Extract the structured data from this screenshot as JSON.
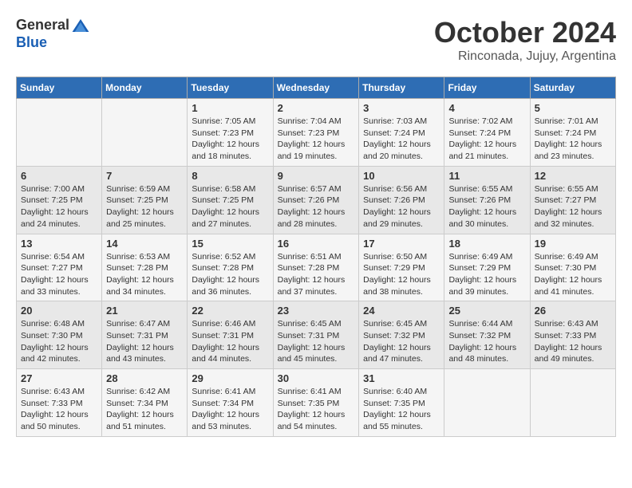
{
  "logo": {
    "general": "General",
    "blue": "Blue"
  },
  "title": "October 2024",
  "location": "Rinconada, Jujuy, Argentina",
  "weekdays": [
    "Sunday",
    "Monday",
    "Tuesday",
    "Wednesday",
    "Thursday",
    "Friday",
    "Saturday"
  ],
  "weeks": [
    [
      {
        "day": "",
        "info": ""
      },
      {
        "day": "",
        "info": ""
      },
      {
        "day": "1",
        "info": "Sunrise: 7:05 AM\nSunset: 7:23 PM\nDaylight: 12 hours\nand 18 minutes."
      },
      {
        "day": "2",
        "info": "Sunrise: 7:04 AM\nSunset: 7:23 PM\nDaylight: 12 hours\nand 19 minutes."
      },
      {
        "day": "3",
        "info": "Sunrise: 7:03 AM\nSunset: 7:24 PM\nDaylight: 12 hours\nand 20 minutes."
      },
      {
        "day": "4",
        "info": "Sunrise: 7:02 AM\nSunset: 7:24 PM\nDaylight: 12 hours\nand 21 minutes."
      },
      {
        "day": "5",
        "info": "Sunrise: 7:01 AM\nSunset: 7:24 PM\nDaylight: 12 hours\nand 23 minutes."
      }
    ],
    [
      {
        "day": "6",
        "info": "Sunrise: 7:00 AM\nSunset: 7:25 PM\nDaylight: 12 hours\nand 24 minutes."
      },
      {
        "day": "7",
        "info": "Sunrise: 6:59 AM\nSunset: 7:25 PM\nDaylight: 12 hours\nand 25 minutes."
      },
      {
        "day": "8",
        "info": "Sunrise: 6:58 AM\nSunset: 7:25 PM\nDaylight: 12 hours\nand 27 minutes."
      },
      {
        "day": "9",
        "info": "Sunrise: 6:57 AM\nSunset: 7:26 PM\nDaylight: 12 hours\nand 28 minutes."
      },
      {
        "day": "10",
        "info": "Sunrise: 6:56 AM\nSunset: 7:26 PM\nDaylight: 12 hours\nand 29 minutes."
      },
      {
        "day": "11",
        "info": "Sunrise: 6:55 AM\nSunset: 7:26 PM\nDaylight: 12 hours\nand 30 minutes."
      },
      {
        "day": "12",
        "info": "Sunrise: 6:55 AM\nSunset: 7:27 PM\nDaylight: 12 hours\nand 32 minutes."
      }
    ],
    [
      {
        "day": "13",
        "info": "Sunrise: 6:54 AM\nSunset: 7:27 PM\nDaylight: 12 hours\nand 33 minutes."
      },
      {
        "day": "14",
        "info": "Sunrise: 6:53 AM\nSunset: 7:28 PM\nDaylight: 12 hours\nand 34 minutes."
      },
      {
        "day": "15",
        "info": "Sunrise: 6:52 AM\nSunset: 7:28 PM\nDaylight: 12 hours\nand 36 minutes."
      },
      {
        "day": "16",
        "info": "Sunrise: 6:51 AM\nSunset: 7:28 PM\nDaylight: 12 hours\nand 37 minutes."
      },
      {
        "day": "17",
        "info": "Sunrise: 6:50 AM\nSunset: 7:29 PM\nDaylight: 12 hours\nand 38 minutes."
      },
      {
        "day": "18",
        "info": "Sunrise: 6:49 AM\nSunset: 7:29 PM\nDaylight: 12 hours\nand 39 minutes."
      },
      {
        "day": "19",
        "info": "Sunrise: 6:49 AM\nSunset: 7:30 PM\nDaylight: 12 hours\nand 41 minutes."
      }
    ],
    [
      {
        "day": "20",
        "info": "Sunrise: 6:48 AM\nSunset: 7:30 PM\nDaylight: 12 hours\nand 42 minutes."
      },
      {
        "day": "21",
        "info": "Sunrise: 6:47 AM\nSunset: 7:31 PM\nDaylight: 12 hours\nand 43 minutes."
      },
      {
        "day": "22",
        "info": "Sunrise: 6:46 AM\nSunset: 7:31 PM\nDaylight: 12 hours\nand 44 minutes."
      },
      {
        "day": "23",
        "info": "Sunrise: 6:45 AM\nSunset: 7:31 PM\nDaylight: 12 hours\nand 45 minutes."
      },
      {
        "day": "24",
        "info": "Sunrise: 6:45 AM\nSunset: 7:32 PM\nDaylight: 12 hours\nand 47 minutes."
      },
      {
        "day": "25",
        "info": "Sunrise: 6:44 AM\nSunset: 7:32 PM\nDaylight: 12 hours\nand 48 minutes."
      },
      {
        "day": "26",
        "info": "Sunrise: 6:43 AM\nSunset: 7:33 PM\nDaylight: 12 hours\nand 49 minutes."
      }
    ],
    [
      {
        "day": "27",
        "info": "Sunrise: 6:43 AM\nSunset: 7:33 PM\nDaylight: 12 hours\nand 50 minutes."
      },
      {
        "day": "28",
        "info": "Sunrise: 6:42 AM\nSunset: 7:34 PM\nDaylight: 12 hours\nand 51 minutes."
      },
      {
        "day": "29",
        "info": "Sunrise: 6:41 AM\nSunset: 7:34 PM\nDaylight: 12 hours\nand 53 minutes."
      },
      {
        "day": "30",
        "info": "Sunrise: 6:41 AM\nSunset: 7:35 PM\nDaylight: 12 hours\nand 54 minutes."
      },
      {
        "day": "31",
        "info": "Sunrise: 6:40 AM\nSunset: 7:35 PM\nDaylight: 12 hours\nand 55 minutes."
      },
      {
        "day": "",
        "info": ""
      },
      {
        "day": "",
        "info": ""
      }
    ]
  ]
}
